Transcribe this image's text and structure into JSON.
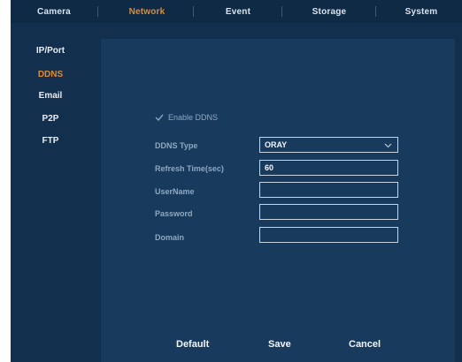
{
  "tabs": [
    {
      "label": "Camera",
      "active": false
    },
    {
      "label": "Network",
      "active": true
    },
    {
      "label": "Event",
      "active": false
    },
    {
      "label": "Storage",
      "active": false
    },
    {
      "label": "System",
      "active": false
    }
  ],
  "sidebar": {
    "items": [
      {
        "label": "IP/Port",
        "active": false
      },
      {
        "label": "DDNS",
        "active": true
      },
      {
        "label": "Email",
        "active": false
      },
      {
        "label": "P2P",
        "active": false
      },
      {
        "label": "FTP",
        "active": false
      }
    ]
  },
  "ddns": {
    "enable_label": "Enable DDNS",
    "enabled": true,
    "type_label": "DDNS Type",
    "type_value": "ORAY",
    "refresh_label": "Refresh Time(sec)",
    "refresh_value": "60",
    "username_label": "UserName",
    "username_value": "",
    "password_label": "Password",
    "password_value": "",
    "domain_label": "Domain",
    "domain_value": ""
  },
  "footer": {
    "default_label": "Default",
    "save_label": "Save",
    "cancel_label": "Cancel"
  },
  "colors": {
    "accent": "#e08a2c",
    "background": "#12304d",
    "panel": "#183a5c"
  },
  "icons": {
    "enable_check": "check-icon",
    "type_dropdown": "chevron-down-icon"
  }
}
